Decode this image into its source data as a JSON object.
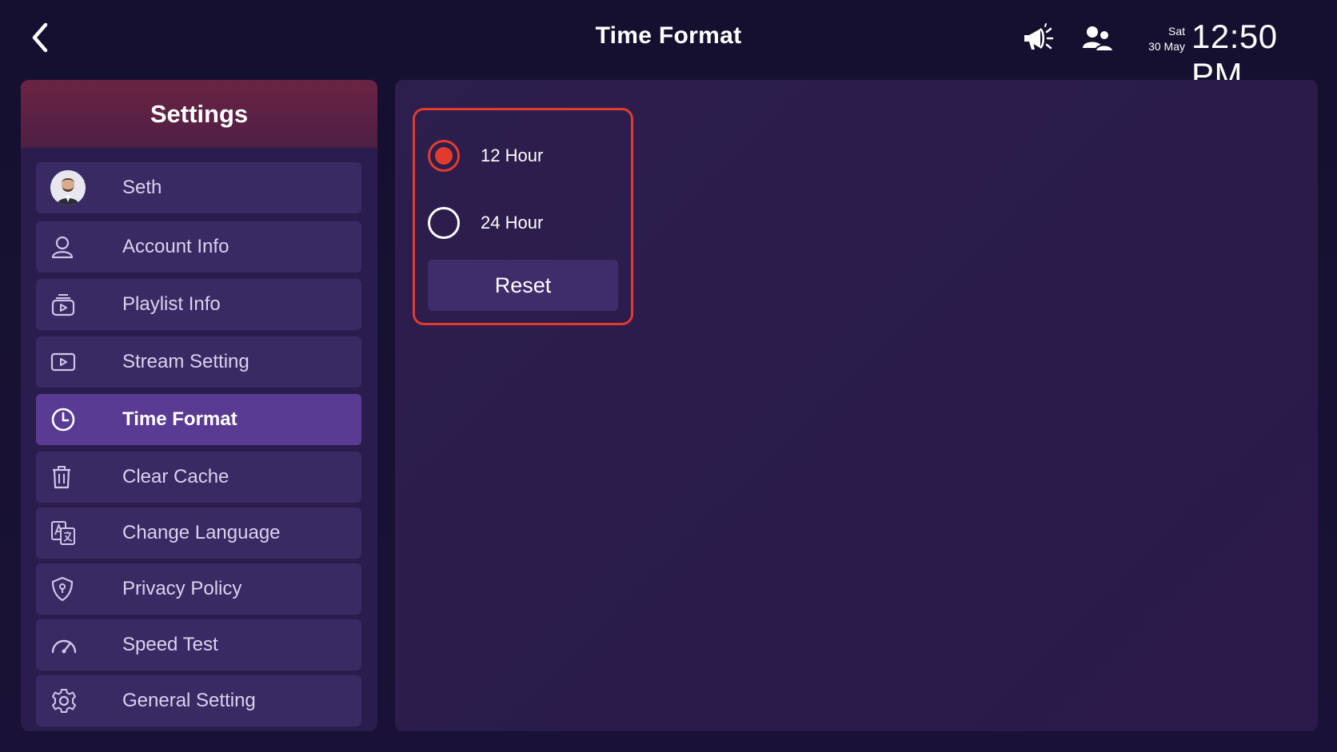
{
  "header": {
    "back_icon": "chevron-left-icon",
    "title": "Time Format",
    "announcement_icon": "megaphone-icon",
    "users_icon": "users-icon",
    "day": "Sat",
    "date": "30 May",
    "time": "12:50 PM"
  },
  "sidebar": {
    "title": "Settings",
    "items": [
      {
        "label": "Seth",
        "icon": "avatar"
      },
      {
        "label": "Account Info",
        "icon": "user-icon"
      },
      {
        "label": "Playlist Info",
        "icon": "playlist-icon"
      },
      {
        "label": "Stream Setting",
        "icon": "stream-icon"
      },
      {
        "label": "Time Format",
        "icon": "clock-icon",
        "active": true
      },
      {
        "label": "Clear Cache",
        "icon": "trash-icon"
      },
      {
        "label": "Change Language",
        "icon": "language-icon"
      },
      {
        "label": "Privacy Policy",
        "icon": "shield-icon"
      },
      {
        "label": "Speed Test",
        "icon": "speedometer-icon"
      },
      {
        "label": "General Setting",
        "icon": "gear-icon"
      }
    ]
  },
  "time_format": {
    "options": [
      {
        "label": "12 Hour",
        "selected": true
      },
      {
        "label": "24 Hour",
        "selected": false
      }
    ],
    "reset_label": "Reset"
  },
  "colors": {
    "accent": "#e23b2e",
    "active_item": "#5a3b93",
    "background": "#140f2e"
  }
}
